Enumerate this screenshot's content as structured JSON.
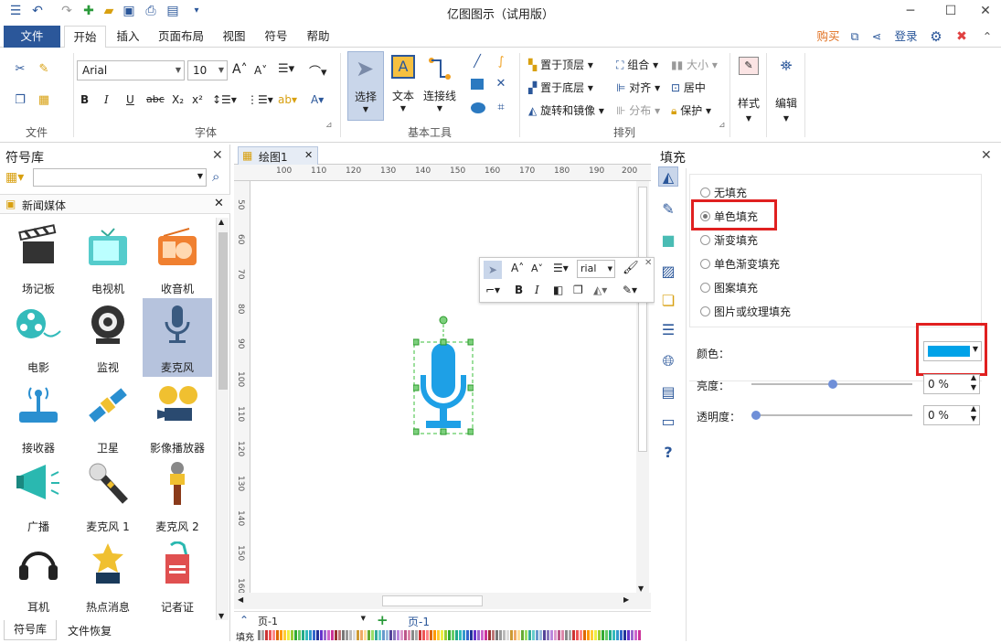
{
  "app": {
    "title": "亿图图示（试用版）"
  },
  "menu": {
    "file": "文件",
    "tabs": [
      "开始",
      "插入",
      "页面布局",
      "视图",
      "符号",
      "帮助"
    ],
    "right": {
      "buy": "购买",
      "login": "登录"
    }
  },
  "ribbon": {
    "groups": {
      "file": "文件",
      "font": "字体",
      "basic_tools": "基本工具",
      "arrange": "排列"
    },
    "font_name": "Arial",
    "font_size": "10",
    "tools": {
      "select": "选择",
      "text": "文本",
      "connector": "连接线"
    },
    "arrange": {
      "bring_front": "置于顶层",
      "send_back": "置于底层",
      "rotate_mirror": "旋转和镜像",
      "group": "组合",
      "align": "对齐",
      "distribute": "分布",
      "size": "大小",
      "center": "居中",
      "protect": "保护"
    },
    "style": "样式",
    "edit": "编辑"
  },
  "left_panel": {
    "title": "符号库",
    "category": "新闻媒体",
    "symbols": [
      "场记板",
      "电视机",
      "收音机",
      "电影",
      "监视",
      "麦克风",
      "接收器",
      "卫星",
      "影像播放器",
      "广播",
      "麦克风 1",
      "麦克风 2",
      "耳机",
      "热点消息",
      "记者证"
    ],
    "selected": "麦克风",
    "bottom_tabs": [
      "符号库",
      "文件恢复"
    ]
  },
  "canvas": {
    "tab": "绘图1",
    "ruler_h": [
      "100",
      "110",
      "120",
      "130",
      "140",
      "150",
      "160",
      "170",
      "180",
      "190",
      "200"
    ],
    "ruler_v": [
      "50",
      "60",
      "70",
      "80",
      "90",
      "100",
      "110",
      "120",
      "130",
      "140",
      "150",
      "160"
    ],
    "float_toolbar_font": "rial",
    "page_selector": "页-1",
    "page_tab": "页-1",
    "fill_label": "填充"
  },
  "right_panel": {
    "title": "填充",
    "options": [
      "无填充",
      "单色填充",
      "渐变填充",
      "单色渐变填充",
      "图案填充",
      "图片或纹理填充"
    ],
    "selected_option": "单色填充",
    "color_label": "颜色：",
    "color_value": "#00a2e8",
    "brightness_label": "亮度：",
    "brightness_value": "0 %",
    "transparency_label": "透明度：",
    "transparency_value": "0 %"
  },
  "colors": {
    "accent": "#2b579a",
    "highlight": "#e02020",
    "mic_blue": "#1ea0e6",
    "selection": "#b6c3dd"
  }
}
